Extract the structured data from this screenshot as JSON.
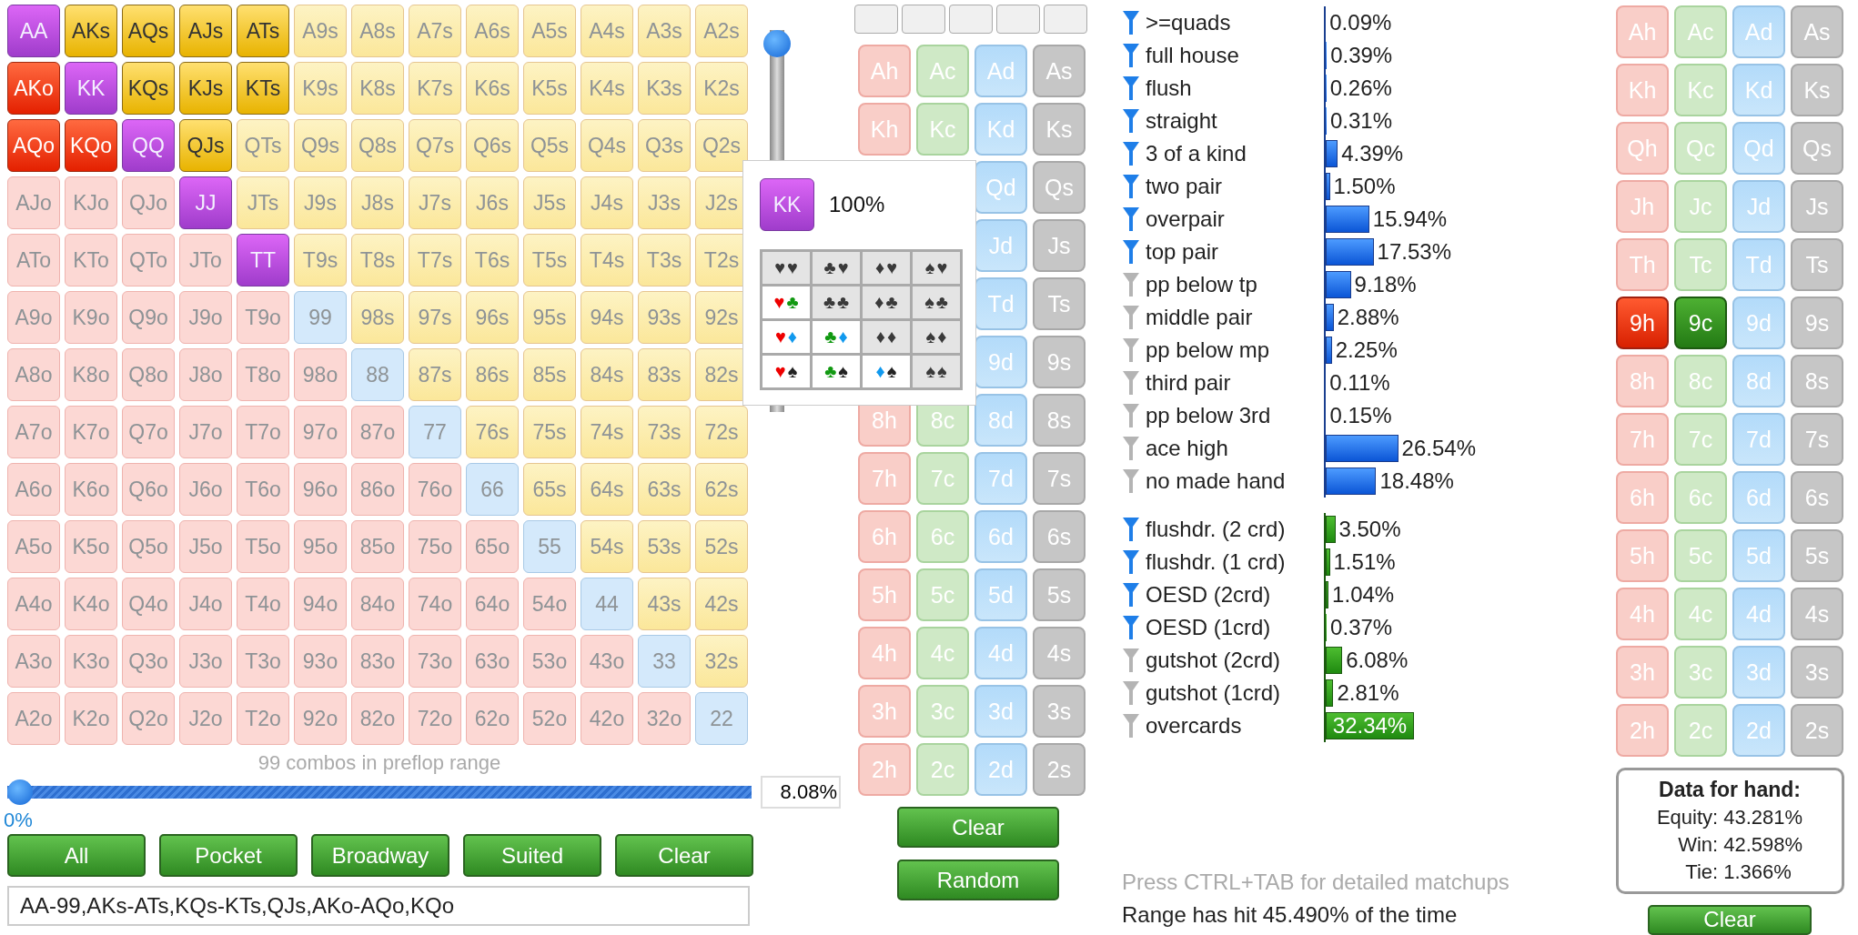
{
  "hand_grid": {
    "rows": [
      {
        "cells": [
          {
            "hand": "AA",
            "kind": "pair",
            "selected": true
          },
          {
            "hand": "AKs",
            "kind": "suited",
            "selected": true
          },
          {
            "hand": "AQs",
            "kind": "suited",
            "selected": true
          },
          {
            "hand": "AJs",
            "kind": "suited",
            "selected": true
          },
          {
            "hand": "ATs",
            "kind": "suited",
            "selected": true
          },
          {
            "hand": "A9s",
            "kind": "suited",
            "selected": false
          },
          {
            "hand": "A8s",
            "kind": "suited",
            "selected": false
          },
          {
            "hand": "A7s",
            "kind": "suited",
            "selected": false
          },
          {
            "hand": "A6s",
            "kind": "suited",
            "selected": false
          },
          {
            "hand": "A5s",
            "kind": "suited",
            "selected": false
          },
          {
            "hand": "A4s",
            "kind": "suited",
            "selected": false
          },
          {
            "hand": "A3s",
            "kind": "suited",
            "selected": false
          },
          {
            "hand": "A2s",
            "kind": "suited",
            "selected": false
          }
        ]
      },
      {
        "cells": [
          {
            "hand": "AKo",
            "kind": "offsuit",
            "selected": true
          },
          {
            "hand": "KK",
            "kind": "pair",
            "selected": true
          },
          {
            "hand": "KQs",
            "kind": "suited",
            "selected": true
          },
          {
            "hand": "KJs",
            "kind": "suited",
            "selected": true
          },
          {
            "hand": "KTs",
            "kind": "suited",
            "selected": true
          },
          {
            "hand": "K9s",
            "kind": "suited",
            "selected": false
          },
          {
            "hand": "K8s",
            "kind": "suited",
            "selected": false
          },
          {
            "hand": "K7s",
            "kind": "suited",
            "selected": false
          },
          {
            "hand": "K6s",
            "kind": "suited",
            "selected": false
          },
          {
            "hand": "K5s",
            "kind": "suited",
            "selected": false
          },
          {
            "hand": "K4s",
            "kind": "suited",
            "selected": false
          },
          {
            "hand": "K3s",
            "kind": "suited",
            "selected": false
          },
          {
            "hand": "K2s",
            "kind": "suited",
            "selected": false
          }
        ]
      },
      {
        "cells": [
          {
            "hand": "AQo",
            "kind": "offsuit",
            "selected": true
          },
          {
            "hand": "KQo",
            "kind": "offsuit",
            "selected": true
          },
          {
            "hand": "QQ",
            "kind": "pair",
            "selected": true
          },
          {
            "hand": "QJs",
            "kind": "suited",
            "selected": true
          },
          {
            "hand": "QTs",
            "kind": "suited",
            "selected": false
          },
          {
            "hand": "Q9s",
            "kind": "suited",
            "selected": false
          },
          {
            "hand": "Q8s",
            "kind": "suited",
            "selected": false
          },
          {
            "hand": "Q7s",
            "kind": "suited",
            "selected": false
          },
          {
            "hand": "Q6s",
            "kind": "suited",
            "selected": false
          },
          {
            "hand": "Q5s",
            "kind": "suited",
            "selected": false
          },
          {
            "hand": "Q4s",
            "kind": "suited",
            "selected": false
          },
          {
            "hand": "Q3s",
            "kind": "suited",
            "selected": false
          },
          {
            "hand": "Q2s",
            "kind": "suited",
            "selected": false
          }
        ]
      },
      {
        "cells": [
          {
            "hand": "AJo",
            "kind": "offsuit",
            "selected": false
          },
          {
            "hand": "KJo",
            "kind": "offsuit",
            "selected": false
          },
          {
            "hand": "QJo",
            "kind": "offsuit",
            "selected": false
          },
          {
            "hand": "JJ",
            "kind": "pair",
            "selected": true
          },
          {
            "hand": "JTs",
            "kind": "suited",
            "selected": false
          },
          {
            "hand": "J9s",
            "kind": "suited",
            "selected": false
          },
          {
            "hand": "J8s",
            "kind": "suited",
            "selected": false
          },
          {
            "hand": "J7s",
            "kind": "suited",
            "selected": false
          },
          {
            "hand": "J6s",
            "kind": "suited",
            "selected": false
          },
          {
            "hand": "J5s",
            "kind": "suited",
            "selected": false
          },
          {
            "hand": "J4s",
            "kind": "suited",
            "selected": false
          },
          {
            "hand": "J3s",
            "kind": "suited",
            "selected": false
          },
          {
            "hand": "J2s",
            "kind": "suited",
            "selected": false
          }
        ]
      },
      {
        "cells": [
          {
            "hand": "ATo",
            "kind": "offsuit",
            "selected": false
          },
          {
            "hand": "KTo",
            "kind": "offsuit",
            "selected": false
          },
          {
            "hand": "QTo",
            "kind": "offsuit",
            "selected": false
          },
          {
            "hand": "JTo",
            "kind": "offsuit",
            "selected": false
          },
          {
            "hand": "TT",
            "kind": "pair",
            "selected": true
          },
          {
            "hand": "T9s",
            "kind": "suited",
            "selected": false
          },
          {
            "hand": "T8s",
            "kind": "suited",
            "selected": false
          },
          {
            "hand": "T7s",
            "kind": "suited",
            "selected": false
          },
          {
            "hand": "T6s",
            "kind": "suited",
            "selected": false
          },
          {
            "hand": "T5s",
            "kind": "suited",
            "selected": false
          },
          {
            "hand": "T4s",
            "kind": "suited",
            "selected": false
          },
          {
            "hand": "T3s",
            "kind": "suited",
            "selected": false
          },
          {
            "hand": "T2s",
            "kind": "suited",
            "selected": false
          }
        ]
      },
      {
        "cells": [
          {
            "hand": "A9o",
            "kind": "offsuit",
            "selected": false
          },
          {
            "hand": "K9o",
            "kind": "offsuit",
            "selected": false
          },
          {
            "hand": "Q9o",
            "kind": "offsuit",
            "selected": false
          },
          {
            "hand": "J9o",
            "kind": "offsuit",
            "selected": false
          },
          {
            "hand": "T9o",
            "kind": "offsuit",
            "selected": false
          },
          {
            "hand": "99",
            "kind": "pair",
            "selected": false
          },
          {
            "hand": "98s",
            "kind": "suited",
            "selected": false
          },
          {
            "hand": "97s",
            "kind": "suited",
            "selected": false
          },
          {
            "hand": "96s",
            "kind": "suited",
            "selected": false
          },
          {
            "hand": "95s",
            "kind": "suited",
            "selected": false
          },
          {
            "hand": "94s",
            "kind": "suited",
            "selected": false
          },
          {
            "hand": "93s",
            "kind": "suited",
            "selected": false
          },
          {
            "hand": "92s",
            "kind": "suited",
            "selected": false
          }
        ]
      },
      {
        "cells": [
          {
            "hand": "A8o",
            "kind": "offsuit",
            "selected": false
          },
          {
            "hand": "K8o",
            "kind": "offsuit",
            "selected": false
          },
          {
            "hand": "Q8o",
            "kind": "offsuit",
            "selected": false
          },
          {
            "hand": "J8o",
            "kind": "offsuit",
            "selected": false
          },
          {
            "hand": "T8o",
            "kind": "offsuit",
            "selected": false
          },
          {
            "hand": "98o",
            "kind": "offsuit",
            "selected": false
          },
          {
            "hand": "88",
            "kind": "pair",
            "selected": false
          },
          {
            "hand": "87s",
            "kind": "suited",
            "selected": false
          },
          {
            "hand": "86s",
            "kind": "suited",
            "selected": false
          },
          {
            "hand": "85s",
            "kind": "suited",
            "selected": false
          },
          {
            "hand": "84s",
            "kind": "suited",
            "selected": false
          },
          {
            "hand": "83s",
            "kind": "suited",
            "selected": false
          },
          {
            "hand": "82s",
            "kind": "suited",
            "selected": false
          }
        ]
      },
      {
        "cells": [
          {
            "hand": "A7o",
            "kind": "offsuit",
            "selected": false
          },
          {
            "hand": "K7o",
            "kind": "offsuit",
            "selected": false
          },
          {
            "hand": "Q7o",
            "kind": "offsuit",
            "selected": false
          },
          {
            "hand": "J7o",
            "kind": "offsuit",
            "selected": false
          },
          {
            "hand": "T7o",
            "kind": "offsuit",
            "selected": false
          },
          {
            "hand": "97o",
            "kind": "offsuit",
            "selected": false
          },
          {
            "hand": "87o",
            "kind": "offsuit",
            "selected": false
          },
          {
            "hand": "77",
            "kind": "pair",
            "selected": false
          },
          {
            "hand": "76s",
            "kind": "suited",
            "selected": false
          },
          {
            "hand": "75s",
            "kind": "suited",
            "selected": false
          },
          {
            "hand": "74s",
            "kind": "suited",
            "selected": false
          },
          {
            "hand": "73s",
            "kind": "suited",
            "selected": false
          },
          {
            "hand": "72s",
            "kind": "suited",
            "selected": false
          }
        ]
      },
      {
        "cells": [
          {
            "hand": "A6o",
            "kind": "offsuit",
            "selected": false
          },
          {
            "hand": "K6o",
            "kind": "offsuit",
            "selected": false
          },
          {
            "hand": "Q6o",
            "kind": "offsuit",
            "selected": false
          },
          {
            "hand": "J6o",
            "kind": "offsuit",
            "selected": false
          },
          {
            "hand": "T6o",
            "kind": "offsuit",
            "selected": false
          },
          {
            "hand": "96o",
            "kind": "offsuit",
            "selected": false
          },
          {
            "hand": "86o",
            "kind": "offsuit",
            "selected": false
          },
          {
            "hand": "76o",
            "kind": "offsuit",
            "selected": false
          },
          {
            "hand": "66",
            "kind": "pair",
            "selected": false
          },
          {
            "hand": "65s",
            "kind": "suited",
            "selected": false
          },
          {
            "hand": "64s",
            "kind": "suited",
            "selected": false
          },
          {
            "hand": "63s",
            "kind": "suited",
            "selected": false
          },
          {
            "hand": "62s",
            "kind": "suited",
            "selected": false
          }
        ]
      },
      {
        "cells": [
          {
            "hand": "A5o",
            "kind": "offsuit",
            "selected": false
          },
          {
            "hand": "K5o",
            "kind": "offsuit",
            "selected": false
          },
          {
            "hand": "Q5o",
            "kind": "offsuit",
            "selected": false
          },
          {
            "hand": "J5o",
            "kind": "offsuit",
            "selected": false
          },
          {
            "hand": "T5o",
            "kind": "offsuit",
            "selected": false
          },
          {
            "hand": "95o",
            "kind": "offsuit",
            "selected": false
          },
          {
            "hand": "85o",
            "kind": "offsuit",
            "selected": false
          },
          {
            "hand": "75o",
            "kind": "offsuit",
            "selected": false
          },
          {
            "hand": "65o",
            "kind": "offsuit",
            "selected": false
          },
          {
            "hand": "55",
            "kind": "pair",
            "selected": false
          },
          {
            "hand": "54s",
            "kind": "suited",
            "selected": false
          },
          {
            "hand": "53s",
            "kind": "suited",
            "selected": false
          },
          {
            "hand": "52s",
            "kind": "suited",
            "selected": false
          }
        ]
      },
      {
        "cells": [
          {
            "hand": "A4o",
            "kind": "offsuit",
            "selected": false
          },
          {
            "hand": "K4o",
            "kind": "offsuit",
            "selected": false
          },
          {
            "hand": "Q4o",
            "kind": "offsuit",
            "selected": false
          },
          {
            "hand": "J4o",
            "kind": "offsuit",
            "selected": false
          },
          {
            "hand": "T4o",
            "kind": "offsuit",
            "selected": false
          },
          {
            "hand": "94o",
            "kind": "offsuit",
            "selected": false
          },
          {
            "hand": "84o",
            "kind": "offsuit",
            "selected": false
          },
          {
            "hand": "74o",
            "kind": "offsuit",
            "selected": false
          },
          {
            "hand": "64o",
            "kind": "offsuit",
            "selected": false
          },
          {
            "hand": "54o",
            "kind": "offsuit",
            "selected": false
          },
          {
            "hand": "44",
            "kind": "pair",
            "selected": false
          },
          {
            "hand": "43s",
            "kind": "suited",
            "selected": false
          },
          {
            "hand": "42s",
            "kind": "suited",
            "selected": false
          }
        ]
      },
      {
        "cells": [
          {
            "hand": "A3o",
            "kind": "offsuit",
            "selected": false
          },
          {
            "hand": "K3o",
            "kind": "offsuit",
            "selected": false
          },
          {
            "hand": "Q3o",
            "kind": "offsuit",
            "selected": false
          },
          {
            "hand": "J3o",
            "kind": "offsuit",
            "selected": false
          },
          {
            "hand": "T3o",
            "kind": "offsuit",
            "selected": false
          },
          {
            "hand": "93o",
            "kind": "offsuit",
            "selected": false
          },
          {
            "hand": "83o",
            "kind": "offsuit",
            "selected": false
          },
          {
            "hand": "73o",
            "kind": "offsuit",
            "selected": false
          },
          {
            "hand": "63o",
            "kind": "offsuit",
            "selected": false
          },
          {
            "hand": "53o",
            "kind": "offsuit",
            "selected": false
          },
          {
            "hand": "43o",
            "kind": "offsuit",
            "selected": false
          },
          {
            "hand": "33",
            "kind": "pair",
            "selected": false
          },
          {
            "hand": "32s",
            "kind": "suited",
            "selected": false
          }
        ]
      },
      {
        "cells": [
          {
            "hand": "A2o",
            "kind": "offsuit",
            "selected": false
          },
          {
            "hand": "K2o",
            "kind": "offsuit",
            "selected": false
          },
          {
            "hand": "Q2o",
            "kind": "offsuit",
            "selected": false
          },
          {
            "hand": "J2o",
            "kind": "offsuit",
            "selected": false
          },
          {
            "hand": "T2o",
            "kind": "offsuit",
            "selected": false
          },
          {
            "hand": "92o",
            "kind": "offsuit",
            "selected": false
          },
          {
            "hand": "82o",
            "kind": "offsuit",
            "selected": false
          },
          {
            "hand": "72o",
            "kind": "offsuit",
            "selected": false
          },
          {
            "hand": "62o",
            "kind": "offsuit",
            "selected": false
          },
          {
            "hand": "52o",
            "kind": "offsuit",
            "selected": false
          },
          {
            "hand": "42o",
            "kind": "offsuit",
            "selected": false
          },
          {
            "hand": "32o",
            "kind": "offsuit",
            "selected": false
          },
          {
            "hand": "22",
            "kind": "pair",
            "selected": false
          }
        ]
      }
    ]
  },
  "vertical_slider": {
    "level": 1
  },
  "combo_caption": "99 combos in preflop range",
  "range_slider": {
    "level": 0,
    "min_label": "0%",
    "value": "8.08%"
  },
  "range_buttons": [
    "All",
    "Pocket",
    "Broadway",
    "Suited",
    "Clear"
  ],
  "range_text": "AA-99,AKs-ATs,KQs-KTs,QJs,AKo-AQo,KQo",
  "hand_popup": {
    "hand": {
      "label": "KK",
      "kind": "pair",
      "selected": true
    },
    "share": "100%",
    "combos": [
      {
        "cells": [
          {
            "first": "♥",
            "second": "♥",
            "active": false
          },
          {
            "first": "♣",
            "second": "♥",
            "active": false
          },
          {
            "first": "♦",
            "second": "♥",
            "active": false
          },
          {
            "first": "♠",
            "second": "♥",
            "active": false
          }
        ]
      },
      {
        "cells": [
          {
            "first": "♥",
            "second": "♣",
            "active": true
          },
          {
            "first": "♣",
            "second": "♣",
            "active": false
          },
          {
            "first": "♦",
            "second": "♣",
            "active": false
          },
          {
            "first": "♠",
            "second": "♣",
            "active": false
          }
        ]
      },
      {
        "cells": [
          {
            "first": "♥",
            "second": "♦",
            "active": true
          },
          {
            "first": "♣",
            "second": "♦",
            "active": true
          },
          {
            "first": "♦",
            "second": "♦",
            "active": false
          },
          {
            "first": "♠",
            "second": "♦",
            "active": false
          }
        ]
      },
      {
        "cells": [
          {
            "first": "♥",
            "second": "♠",
            "active": true
          },
          {
            "first": "♣",
            "second": "♠",
            "active": true
          },
          {
            "first": "♦",
            "second": "♠",
            "active": true
          },
          {
            "first": "♠",
            "second": "♠",
            "active": false
          }
        ]
      }
    ]
  },
  "deck": {
    "rows": [
      {
        "cards": [
          {
            "label": "Ah",
            "kind": "hearts"
          },
          {
            "label": "Ac",
            "kind": "clubs"
          },
          {
            "label": "Ad",
            "kind": "diamonds"
          },
          {
            "label": "As",
            "kind": "spades"
          }
        ]
      },
      {
        "cards": [
          {
            "label": "Kh",
            "kind": "hearts"
          },
          {
            "label": "Kc",
            "kind": "clubs"
          },
          {
            "label": "Kd",
            "kind": "diamonds"
          },
          {
            "label": "Ks",
            "kind": "spades"
          }
        ]
      },
      {
        "cards": [
          {
            "label": "Qd",
            "kind": "diamonds"
          },
          {
            "label": "Qs",
            "kind": "spades"
          }
        ]
      },
      {
        "cards": [
          {
            "label": "Jd",
            "kind": "diamonds"
          },
          {
            "label": "Js",
            "kind": "spades"
          }
        ]
      },
      {
        "cards": [
          {
            "label": "Td",
            "kind": "diamonds"
          },
          {
            "label": "Ts",
            "kind": "spades"
          }
        ]
      },
      {
        "cards": [
          {
            "label": "9d",
            "kind": "diamonds"
          },
          {
            "label": "9s",
            "kind": "spades"
          }
        ]
      },
      {
        "cards": [
          {
            "label": "8h",
            "kind": "hearts"
          },
          {
            "label": "8c",
            "kind": "clubs"
          },
          {
            "label": "8d",
            "kind": "diamonds"
          },
          {
            "label": "8s",
            "kind": "spades"
          }
        ]
      },
      {
        "cards": [
          {
            "label": "7h",
            "kind": "hearts"
          },
          {
            "label": "7c",
            "kind": "clubs"
          },
          {
            "label": "7d",
            "kind": "diamonds"
          },
          {
            "label": "7s",
            "kind": "spades"
          }
        ]
      },
      {
        "cards": [
          {
            "label": "6h",
            "kind": "hearts"
          },
          {
            "label": "6c",
            "kind": "clubs"
          },
          {
            "label": "6d",
            "kind": "diamonds"
          },
          {
            "label": "6s",
            "kind": "spades"
          }
        ]
      },
      {
        "cards": [
          {
            "label": "5h",
            "kind": "hearts"
          },
          {
            "label": "5c",
            "kind": "clubs"
          },
          {
            "label": "5d",
            "kind": "diamonds"
          },
          {
            "label": "5s",
            "kind": "spades"
          }
        ]
      },
      {
        "cards": [
          {
            "label": "4h",
            "kind": "hearts"
          },
          {
            "label": "4c",
            "kind": "clubs"
          },
          {
            "label": "4d",
            "kind": "diamonds"
          },
          {
            "label": "4s",
            "kind": "spades"
          }
        ]
      },
      {
        "cards": [
          {
            "label": "3h",
            "kind": "hearts"
          },
          {
            "label": "3c",
            "kind": "clubs"
          },
          {
            "label": "3d",
            "kind": "diamonds"
          },
          {
            "label": "3s",
            "kind": "spades"
          }
        ]
      },
      {
        "cards": [
          {
            "label": "2h",
            "kind": "hearts"
          },
          {
            "label": "2c",
            "kind": "clubs"
          },
          {
            "label": "2d",
            "kind": "diamonds"
          },
          {
            "label": "2s",
            "kind": "spades"
          }
        ]
      }
    ]
  },
  "deck_buttons": [
    "Clear",
    "Random"
  ],
  "made_hands": [
    {
      "label": ">=quads",
      "filter_on": true,
      "level": 0.0009,
      "value": "0.09%"
    },
    {
      "label": "full house",
      "filter_on": true,
      "level": 0.0039,
      "value": "0.39%"
    },
    {
      "label": "flush",
      "filter_on": true,
      "level": 0.0026,
      "value": "0.26%"
    },
    {
      "label": "straight",
      "filter_on": true,
      "level": 0.0031,
      "value": "0.31%"
    },
    {
      "label": "3 of a kind",
      "filter_on": true,
      "level": 0.0439,
      "value": "4.39%"
    },
    {
      "label": "two pair",
      "filter_on": true,
      "level": 0.015,
      "value": "1.50%"
    },
    {
      "label": "overpair",
      "filter_on": true,
      "level": 0.1594,
      "value": "15.94%"
    },
    {
      "label": "top pair",
      "filter_on": true,
      "level": 0.1753,
      "value": "17.53%"
    },
    {
      "label": "pp below tp",
      "filter_on": false,
      "level": 0.0918,
      "value": "9.18%"
    },
    {
      "label": "middle pair",
      "filter_on": false,
      "level": 0.0288,
      "value": "2.88%"
    },
    {
      "label": "pp below mp",
      "filter_on": false,
      "level": 0.0225,
      "value": "2.25%"
    },
    {
      "label": "third pair",
      "filter_on": false,
      "level": 0.0011,
      "value": "0.11%"
    },
    {
      "label": "pp below 3rd",
      "filter_on": false,
      "level": 0.0015,
      "value": "0.15%"
    },
    {
      "label": "ace high",
      "filter_on": false,
      "level": 0.2654,
      "value": "26.54%"
    },
    {
      "label": "no made hand",
      "filter_on": false,
      "level": 0.1848,
      "value": "18.48%"
    }
  ],
  "draws": [
    {
      "label": "flushdr. (2 crd)",
      "filter_on": true,
      "level": 0.035,
      "value": "3.50%"
    },
    {
      "label": "flushdr. (1 crd)",
      "filter_on": true,
      "level": 0.0151,
      "value": "1.51%"
    },
    {
      "label": "OESD (2crd)",
      "filter_on": true,
      "level": 0.0104,
      "value": "1.04%"
    },
    {
      "label": "OESD (1crd)",
      "filter_on": true,
      "level": 0.0037,
      "value": "0.37%"
    },
    {
      "label": "gutshot (2crd)",
      "filter_on": false,
      "level": 0.0608,
      "value": "6.08%"
    },
    {
      "label": "gutshot (1crd)",
      "filter_on": false,
      "level": 0.0281,
      "value": "2.81%"
    },
    {
      "label": "overcards",
      "filter_on": false,
      "level": 0.3234,
      "value": "32.34%"
    }
  ],
  "hint": "Press CTRL+TAB for detailed matchups",
  "hit_summary": "Range has hit 45.490% of the time",
  "hand_cards": {
    "rows": [
      {
        "cards": [
          {
            "label": "Ah",
            "kind": "hearts",
            "selected": false
          },
          {
            "label": "Ac",
            "kind": "clubs",
            "selected": false
          },
          {
            "label": "Ad",
            "kind": "diamonds",
            "selected": false
          },
          {
            "label": "As",
            "kind": "spades",
            "selected": false
          }
        ]
      },
      {
        "cards": [
          {
            "label": "Kh",
            "kind": "hearts",
            "selected": false
          },
          {
            "label": "Kc",
            "kind": "clubs",
            "selected": false
          },
          {
            "label": "Kd",
            "kind": "diamonds",
            "selected": false
          },
          {
            "label": "Ks",
            "kind": "spades",
            "selected": false
          }
        ]
      },
      {
        "cards": [
          {
            "label": "Qh",
            "kind": "hearts",
            "selected": false
          },
          {
            "label": "Qc",
            "kind": "clubs",
            "selected": false
          },
          {
            "label": "Qd",
            "kind": "diamonds",
            "selected": false
          },
          {
            "label": "Qs",
            "kind": "spades",
            "selected": false
          }
        ]
      },
      {
        "cards": [
          {
            "label": "Jh",
            "kind": "hearts",
            "selected": false
          },
          {
            "label": "Jc",
            "kind": "clubs",
            "selected": false
          },
          {
            "label": "Jd",
            "kind": "diamonds",
            "selected": false
          },
          {
            "label": "Js",
            "kind": "spades",
            "selected": false
          }
        ]
      },
      {
        "cards": [
          {
            "label": "Th",
            "kind": "hearts",
            "selected": false
          },
          {
            "label": "Tc",
            "kind": "clubs",
            "selected": false
          },
          {
            "label": "Td",
            "kind": "diamonds",
            "selected": false
          },
          {
            "label": "Ts",
            "kind": "spades",
            "selected": false
          }
        ]
      },
      {
        "cards": [
          {
            "label": "9h",
            "kind": "hearts",
            "selected": true
          },
          {
            "label": "9c",
            "kind": "clubs",
            "selected": true
          },
          {
            "label": "9d",
            "kind": "diamonds",
            "selected": false
          },
          {
            "label": "9s",
            "kind": "spades",
            "selected": false
          }
        ]
      },
      {
        "cards": [
          {
            "label": "8h",
            "kind": "hearts",
            "selected": false
          },
          {
            "label": "8c",
            "kind": "clubs",
            "selected": false
          },
          {
            "label": "8d",
            "kind": "diamonds",
            "selected": false
          },
          {
            "label": "8s",
            "kind": "spades",
            "selected": false
          }
        ]
      },
      {
        "cards": [
          {
            "label": "7h",
            "kind": "hearts",
            "selected": false
          },
          {
            "label": "7c",
            "kind": "clubs",
            "selected": false
          },
          {
            "label": "7d",
            "kind": "diamonds",
            "selected": false
          },
          {
            "label": "7s",
            "kind": "spades",
            "selected": false
          }
        ]
      },
      {
        "cards": [
          {
            "label": "6h",
            "kind": "hearts",
            "selected": false
          },
          {
            "label": "6c",
            "kind": "clubs",
            "selected": false
          },
          {
            "label": "6d",
            "kind": "diamonds",
            "selected": false
          },
          {
            "label": "6s",
            "kind": "spades",
            "selected": false
          }
        ]
      },
      {
        "cards": [
          {
            "label": "5h",
            "kind": "hearts",
            "selected": false
          },
          {
            "label": "5c",
            "kind": "clubs",
            "selected": false
          },
          {
            "label": "5d",
            "kind": "diamonds",
            "selected": false
          },
          {
            "label": "5s",
            "kind": "spades",
            "selected": false
          }
        ]
      },
      {
        "cards": [
          {
            "label": "4h",
            "kind": "hearts",
            "selected": false
          },
          {
            "label": "4c",
            "kind": "clubs",
            "selected": false
          },
          {
            "label": "4d",
            "kind": "diamonds",
            "selected": false
          },
          {
            "label": "4s",
            "kind": "spades",
            "selected": false
          }
        ]
      },
      {
        "cards": [
          {
            "label": "3h",
            "kind": "hearts",
            "selected": false
          },
          {
            "label": "3c",
            "kind": "clubs",
            "selected": false
          },
          {
            "label": "3d",
            "kind": "diamonds",
            "selected": false
          },
          {
            "label": "3s",
            "kind": "spades",
            "selected": false
          }
        ]
      },
      {
        "cards": [
          {
            "label": "2h",
            "kind": "hearts",
            "selected": false
          },
          {
            "label": "2c",
            "kind": "clubs",
            "selected": false
          },
          {
            "label": "2d",
            "kind": "diamonds",
            "selected": false
          },
          {
            "label": "2s",
            "kind": "spades",
            "selected": false
          }
        ]
      }
    ]
  },
  "hand_data": {
    "title": "Data for hand:",
    "stats": [
      {
        "label": "Equity:",
        "value": "43.281%"
      },
      {
        "label": "Win:",
        "value": "42.598%"
      },
      {
        "label": "Tie:",
        "value": "1.366%"
      }
    ]
  },
  "hand_clear_button": "Clear"
}
